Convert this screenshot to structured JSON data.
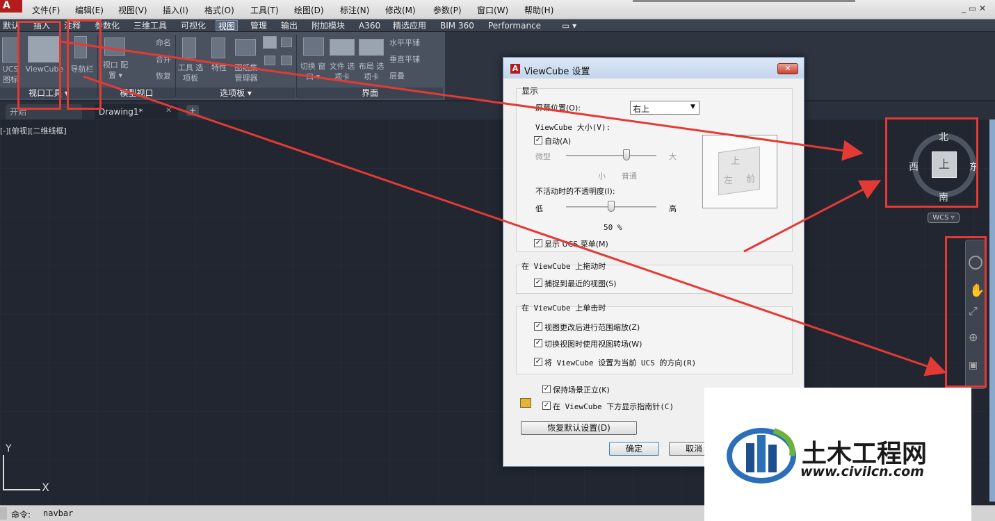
{
  "menubar": {
    "logo": "A",
    "items": [
      "文件(F)",
      "编辑(E)",
      "视图(V)",
      "插入(I)",
      "格式(O)",
      "工具(T)",
      "绘图(D)",
      "标注(N)",
      "修改(M)",
      "参数(P)",
      "窗口(W)",
      "帮助(H)"
    ],
    "window_controls": "_ ▭ ✕"
  },
  "ribbon_tabs": [
    "默认",
    "插入",
    "注释",
    "参数化",
    "三维工具",
    "可视化",
    "视图",
    "管理",
    "输出",
    "附加模块",
    "A360",
    "精选应用",
    "BIM 360",
    "Performance",
    "▭ ▾"
  ],
  "ribbon": {
    "viewport_tools_title": "视口工具 ▾",
    "model_viewport_title": "模型视口",
    "palettes_title": "选项板 ▾",
    "interface_title": "界面",
    "ucs_icon_label": "UCS 图标",
    "viewcube_label": "ViewCube",
    "navbar_label": "导航栏",
    "viewport_config_label": "视口 配置 ▾",
    "name_label": "命名",
    "merge_label": "合并",
    "restore_label": "恢复",
    "tool_palette_label": "工具 选项板",
    "properties_label": "特性",
    "sheetset_label": "图纸集 管理器",
    "switch_window_label": "切换 窗口 ▾",
    "file_tabs_label": "文件 选项卡",
    "layout_tabs_label": "布局 选项卡",
    "tile_h_label": "水平平铺",
    "tile_v_label": "垂直平铺",
    "cascade_label": "层叠"
  },
  "doctabs": {
    "start": "开始",
    "drawing": "Drawing1*",
    "close": "✕",
    "add": "+"
  },
  "view_label": "[-][俯视][二维线框]",
  "ucs": {
    "y": "Y",
    "x": "X"
  },
  "viewcube": {
    "north": "北",
    "south": "南",
    "east": "东",
    "west": "西",
    "top": "上",
    "wcs": "WCS ▿"
  },
  "command": {
    "prompt": "命令:",
    "text": "navbar"
  },
  "dialog": {
    "title": "ViewCube 设置",
    "close": "✕",
    "display_group": "显示",
    "screen_pos_label": "屏幕位置(O):",
    "screen_pos_value": "右上",
    "size_label": "ViewCube 大小(V):",
    "auto_label": "自动(A)",
    "size_tiny": "微型",
    "size_large": "大",
    "size_small": "小",
    "size_normal": "普通",
    "opacity_label": "不活动时的不透明度(I):",
    "opacity_low": "低",
    "opacity_high": "高",
    "opacity_value": "50 %",
    "opacity_fraction": 0.5,
    "show_ucs_label": "显示 UCS 菜单(M)",
    "drag_group": "在 ViewCube 上拖动时",
    "snap_label": "捕捉到最近的视图(S)",
    "click_group": "在 ViewCube 上单击时",
    "zoom_extents_label": "视图更改后进行范围缩放(Z)",
    "transition_label": "切换视图时使用视图转场(W)",
    "set_ucs_label": "将 ViewCube 设置为当前 UCS 的方向(R)",
    "keep_upright_label": "保持场景正立(K)",
    "show_compass_label": "在 ViewCube 下方显示指南针(C)",
    "restore_defaults": "恢复默认设置(D)",
    "ok": "确定",
    "cancel": "取消",
    "cube_top": "上",
    "cube_left": "左",
    "cube_front": "前"
  },
  "watermark": {
    "brand": "土木工程网",
    "url": "www.civilcn.com"
  },
  "colors": {
    "accent_red": "#e43a35",
    "dialog_bg": "#f0f0f0",
    "canvas_bg": "#212630",
    "ribbon_bg": "#4a5260"
  }
}
